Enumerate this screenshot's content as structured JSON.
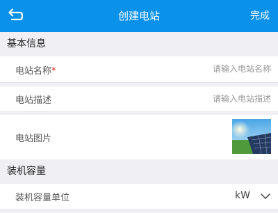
{
  "navbar": {
    "back_icon": "back-arrow-icon",
    "title": "创建电站",
    "done_label": "完成",
    "background": "#0a91ea"
  },
  "sections": {
    "basic_info": {
      "title": "基本信息"
    },
    "capacity": {
      "title": "装机容量"
    }
  },
  "fields": {
    "station_name": {
      "label": "电站名称",
      "required_mark": "*",
      "placeholder": "请输入电站名称",
      "value": ""
    },
    "station_desc": {
      "label": "电站描述",
      "placeholder": "请输入电站描述",
      "value": ""
    },
    "station_image": {
      "label": "电站图片",
      "image_icon": "solar-panel-photo"
    },
    "capacity_unit": {
      "label": "装机容量单位",
      "value": "kW",
      "icon": "chevron-down-icon"
    }
  },
  "colors": {
    "accent": "#0a91ea",
    "required": "#e0231a"
  }
}
